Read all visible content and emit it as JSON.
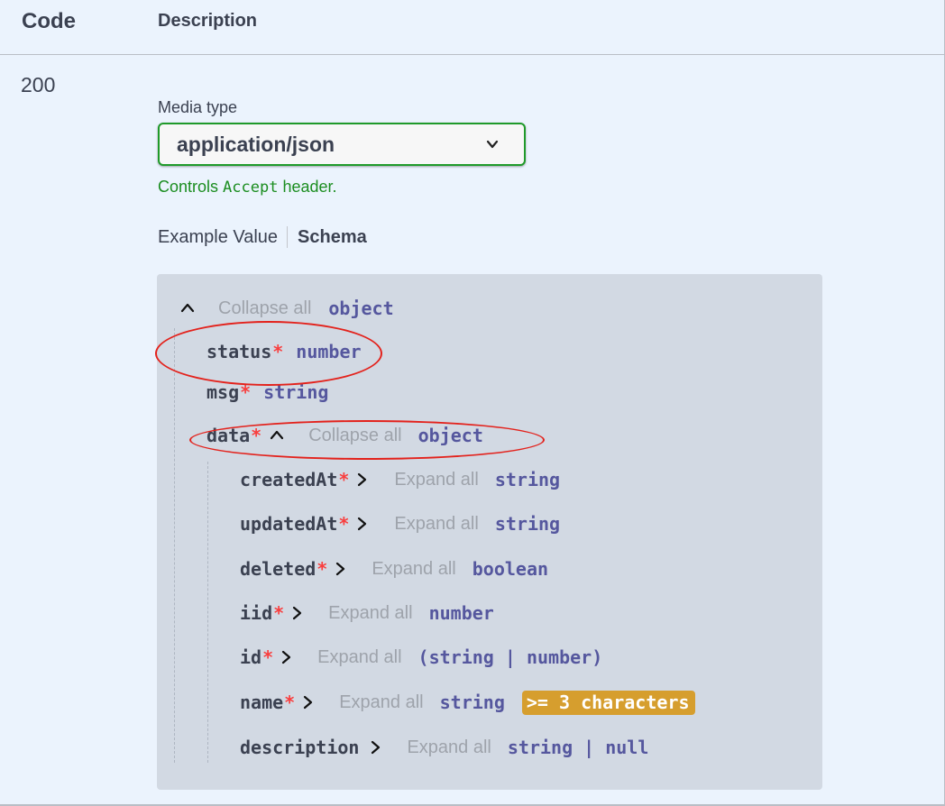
{
  "header": {
    "code": "Code",
    "description": "Description"
  },
  "response": {
    "status_code": "200",
    "media_type_label": "Media type",
    "media_type_value": "application/json",
    "controls_prefix": "Controls",
    "controls_code": "Accept",
    "controls_suffix": "header."
  },
  "tabs": {
    "example": "Example Value",
    "schema": "Schema"
  },
  "schema": {
    "collapse_all": "Collapse all",
    "expand_all": "Expand all",
    "root_type": "object",
    "required_mark": "*",
    "properties": [
      {
        "name": "status",
        "type": "number"
      },
      {
        "name": "msg",
        "type": "string"
      },
      {
        "name": "data",
        "type": "object"
      }
    ],
    "data_properties": [
      {
        "name": "createdAt",
        "type": "string"
      },
      {
        "name": "updatedAt",
        "type": "string"
      },
      {
        "name": "deleted",
        "type": "boolean"
      },
      {
        "name": "iid",
        "type": "number"
      },
      {
        "name": "id",
        "type": "(string | number)"
      },
      {
        "name": "name",
        "type": "string",
        "constraint": ">= 3 characters"
      },
      {
        "name": "description",
        "type": "string | null"
      }
    ]
  },
  "colors": {
    "background": "#ebf3fd",
    "select_border": "#1f9a2a",
    "controls_text": "#1b8d20",
    "schema_box": "#d2d9e3",
    "type_text": "#55579e",
    "required": "#f93e3e",
    "badge": "#d69e2e",
    "annotation": "#e3221c"
  }
}
